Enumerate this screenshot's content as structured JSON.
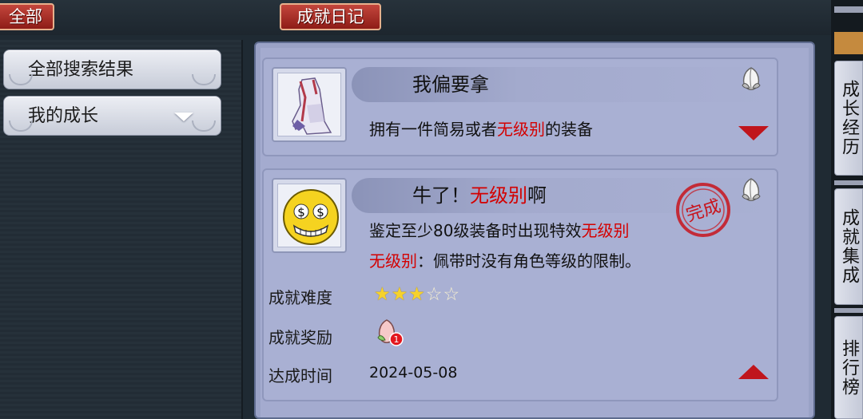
{
  "header": {
    "tab_all": "全部",
    "tab_diary": "成就日记"
  },
  "sidebar": {
    "items": [
      {
        "label": "全部搜索结果"
      },
      {
        "label": "我的成长"
      }
    ]
  },
  "achievements": [
    {
      "icon": "robe-icon",
      "title": "我偏要拿",
      "desc_pre": "拥有一件简易或者",
      "desc_red": "无级别",
      "desc_post": "的装备"
    },
    {
      "icon": "money-eyes-emoji-icon",
      "title_pre": "牛了！",
      "title_red": "无级别",
      "title_post": "啊",
      "desc1_pre": "鉴定至少80级装备时出现特效",
      "desc1_red": "无级别",
      "desc2_red": "无级别",
      "desc2_post": "：佩带时没有角色等级的限制。",
      "difficulty_label": "成就难度",
      "difficulty": 3,
      "difficulty_max": 5,
      "reward_label": "成就奖励",
      "reward_count": "1",
      "time_label": "达成时间",
      "time_value": "2024-05-08",
      "stamp_text": "完成"
    }
  ],
  "right_tabs": [
    "成长经历",
    "成就集成",
    "排行榜"
  ]
}
